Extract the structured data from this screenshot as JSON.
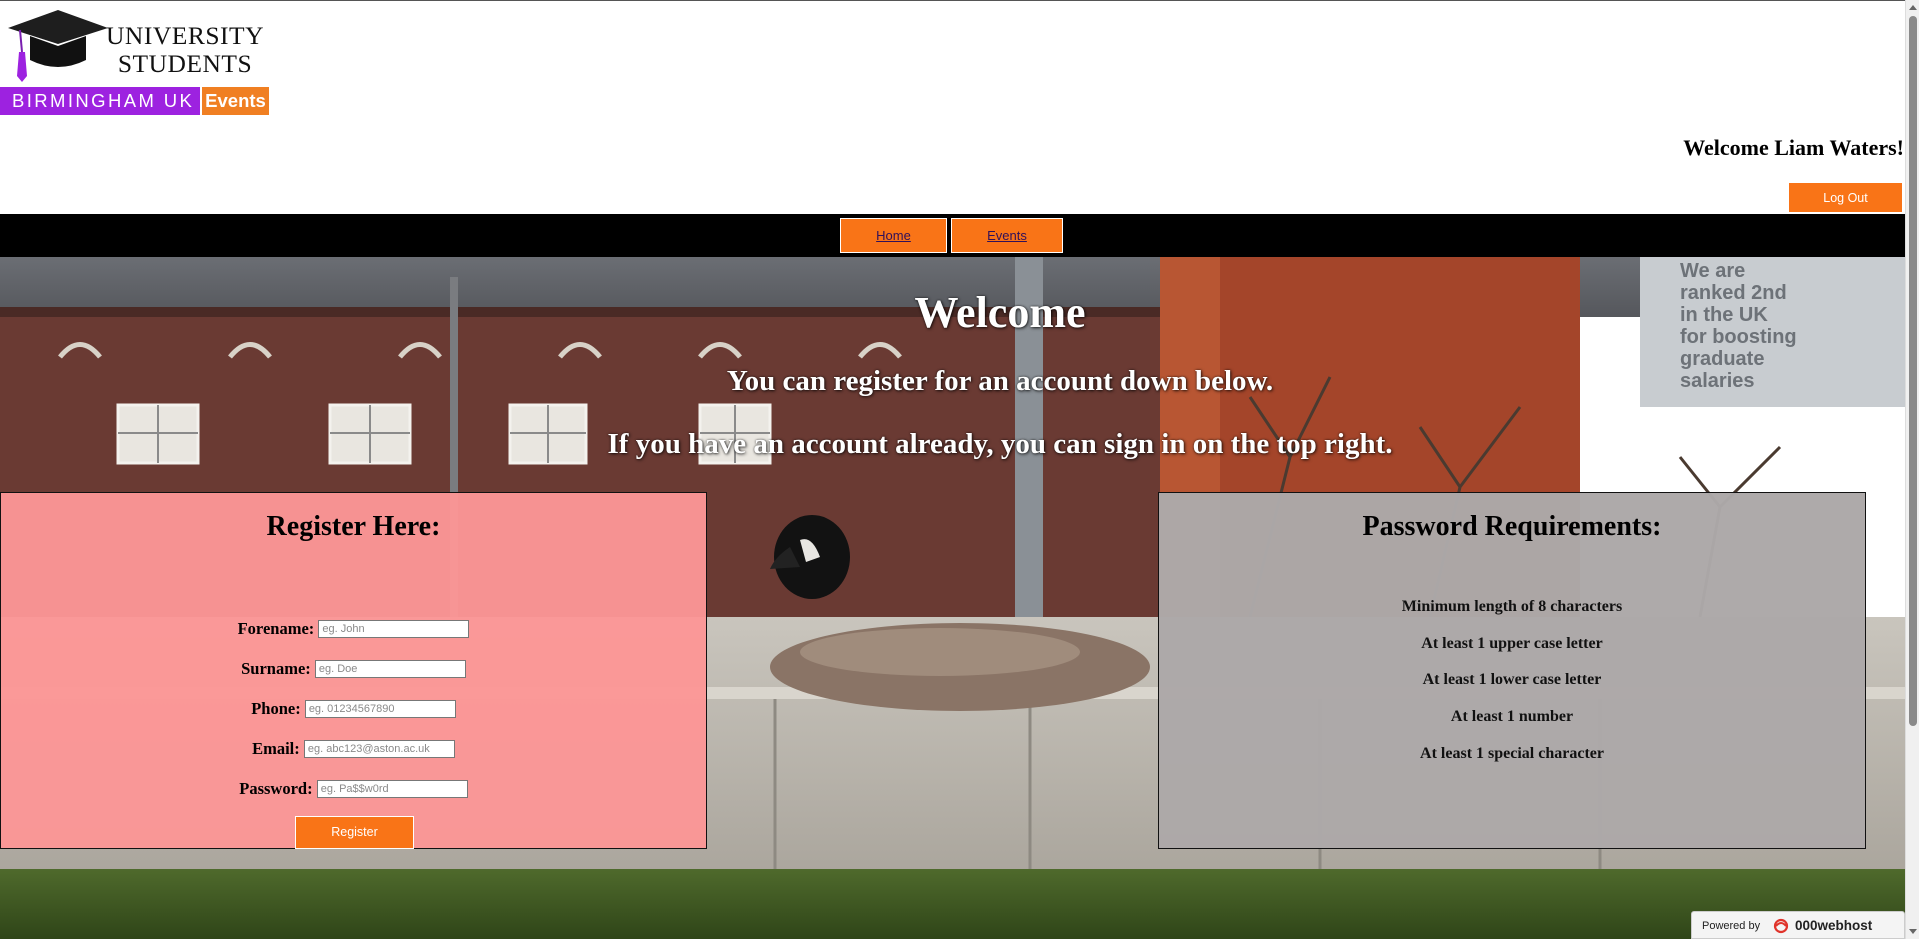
{
  "logo": {
    "line1": "UNIVERSITY",
    "line2": "STUDENTS",
    "city": "BIRMINGHAM UK",
    "tag": "Events",
    "colors": {
      "purple": "#9d22e0",
      "orange": "#f07f22"
    }
  },
  "header": {
    "welcome": "Welcome Liam Waters!",
    "logout_label": "Log Out"
  },
  "nav": {
    "items": [
      {
        "label": "Home"
      },
      {
        "label": "Events"
      }
    ]
  },
  "hero": {
    "title": "Welcome",
    "line1": "You can register for an account down below.",
    "line2": "If you have an account already, you can sign in on the top right.",
    "sign_text": "We are ranked 2nd in the UK for boosting graduate salaries"
  },
  "register": {
    "title": "Register Here:",
    "fields": [
      {
        "label": "Forename:",
        "placeholder": "eg. John"
      },
      {
        "label": "Surname:",
        "placeholder": "eg. Doe"
      },
      {
        "label": "Phone:",
        "placeholder": "eg. 01234567890"
      },
      {
        "label": "Email:",
        "placeholder": "eg. abc123@aston.ac.uk"
      },
      {
        "label": "Password:",
        "placeholder": "eg. Pa$$w0rd"
      }
    ],
    "submit_label": "Register"
  },
  "password_requirements": {
    "title": "Password Requirements:",
    "items": [
      "Minimum length of 8 characters",
      "At least 1 upper case letter",
      "At least 1 lower case letter",
      "At least 1 number",
      "At least 1 special character"
    ]
  },
  "footer_badge": {
    "prefix": "Powered by",
    "brand": "000webhost"
  },
  "colors": {
    "accent_orange": "#f97417",
    "register_panel": "#fc9696",
    "requirements_panel": "#aca8a8"
  }
}
